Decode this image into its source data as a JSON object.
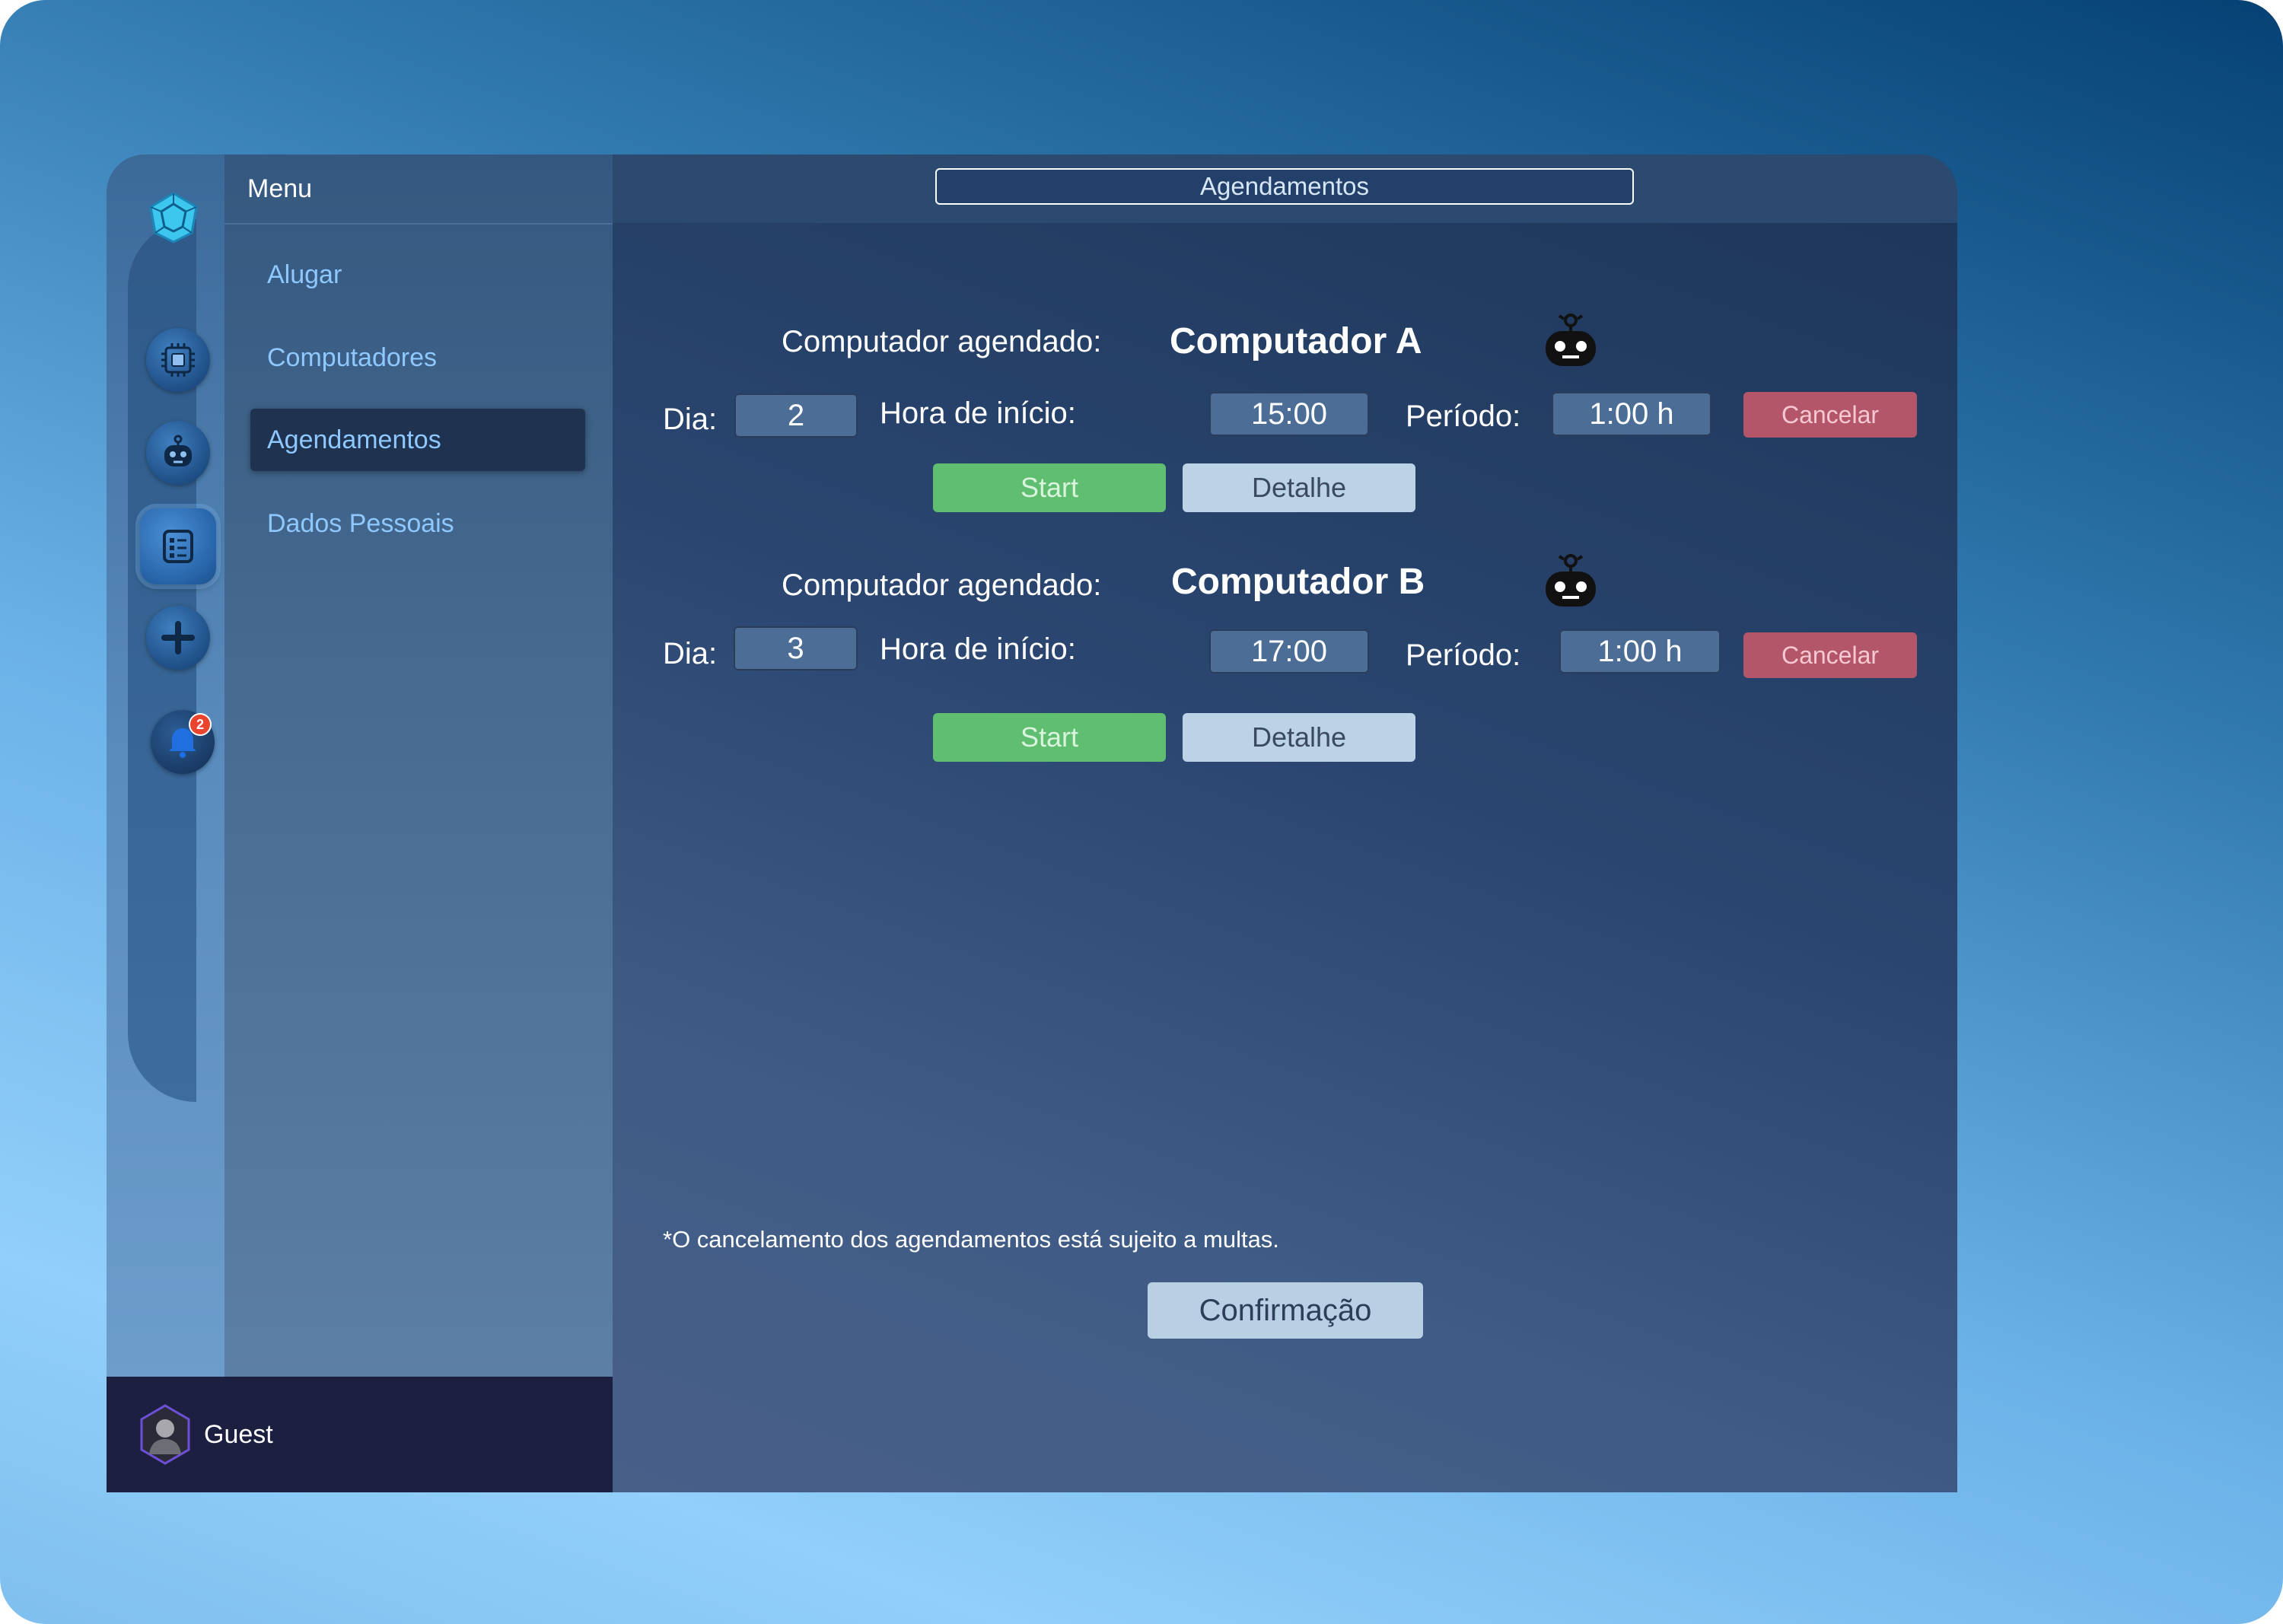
{
  "menu": {
    "header": "Menu",
    "items": [
      {
        "label": "Alugar"
      },
      {
        "label": "Computadores"
      },
      {
        "label": "Agendamentos"
      },
      {
        "label": "Dados Pessoais"
      }
    ]
  },
  "rail": {
    "notification_count": "2"
  },
  "user": {
    "name": "Guest"
  },
  "page": {
    "title": "Agendamentos"
  },
  "labels": {
    "computer": "Computador agendado:",
    "day": "Dia:",
    "start_time": "Hora de início:",
    "period": "Período:",
    "cancel": "Cancelar",
    "start": "Start",
    "detail": "Detalhe"
  },
  "bookings": [
    {
      "computer": "Computador A",
      "day": "2",
      "start_time": "15:00",
      "period": "1:00 h"
    },
    {
      "computer": "Computador B",
      "day": "3",
      "start_time": "17:00",
      "period": "1:00 h"
    }
  ],
  "footer": {
    "note": "*O cancelamento dos agendamentos está sujeito a multas.",
    "confirm": "Confirmação"
  }
}
